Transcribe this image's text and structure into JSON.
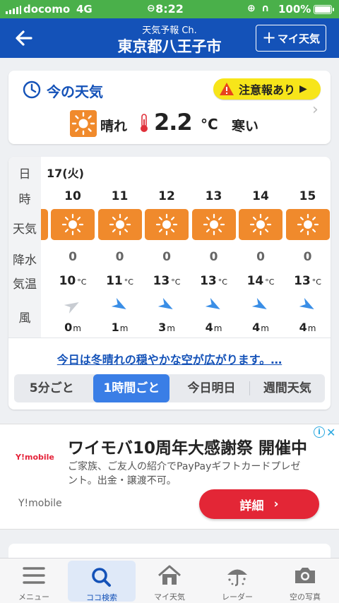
{
  "status_bar": {
    "carrier": "docomo",
    "network": "4G",
    "time": "8:22",
    "battery": "100%"
  },
  "header": {
    "subtitle": "天気予報 Ch.",
    "title": "東京都八王子市",
    "my_weather_button": "マイ天気"
  },
  "current": {
    "title": "今の天気",
    "alert": "注意報あり",
    "condition": "晴れ",
    "temperature": "2.2",
    "unit": "°C",
    "feel": "寒い",
    "icon": "sun-icon"
  },
  "hourly": {
    "labels": {
      "day": "日",
      "hour": "時",
      "weather": "天気",
      "precip": "降水",
      "temp": "気温",
      "wind": "風"
    },
    "date": "17(火)",
    "temp_unit": "°C",
    "wind_unit": "m",
    "hours": [
      {
        "hour": "10",
        "icon": "sun-icon",
        "precip": "0",
        "temp": "10",
        "wind": "0"
      },
      {
        "hour": "11",
        "icon": "sun-icon",
        "precip": "0",
        "temp": "11",
        "wind": "1"
      },
      {
        "hour": "12",
        "icon": "sun-icon",
        "precip": "0",
        "temp": "13",
        "wind": "3"
      },
      {
        "hour": "13",
        "icon": "sun-icon",
        "precip": "0",
        "temp": "13",
        "wind": "4"
      },
      {
        "hour": "14",
        "icon": "sun-icon",
        "precip": "0",
        "temp": "14",
        "wind": "4"
      },
      {
        "hour": "15",
        "icon": "sun-icon",
        "precip": "0",
        "temp": "13",
        "wind": "4"
      }
    ],
    "summary": "今日は冬晴れの穏やかな空が広がります。…",
    "segments": [
      "5分ごと",
      "1時間ごと",
      "今日明日",
      "週間天気"
    ],
    "active_segment": "1時間ごと"
  },
  "ad": {
    "logo": "Y!mobile",
    "title": "ワイモバ10周年大感謝祭 開催中",
    "description": "ご家族、ご友人の紹介でPayPayギフトカードプレゼント。出金・譲渡不可。",
    "brand": "Y!mobile",
    "button": "詳細"
  },
  "tabs": [
    {
      "label": "メニュー",
      "icon": "menu-icon"
    },
    {
      "label": "ココ検索",
      "icon": "search-icon"
    },
    {
      "label": "マイ天気",
      "icon": "home-icon"
    },
    {
      "label": "レーダー",
      "icon": "radar-umbrella-icon"
    },
    {
      "label": "空の写真",
      "icon": "camera-icon"
    }
  ],
  "active_tab": "ココ検索",
  "colors": {
    "status_green": "#4ab04a",
    "header_blue": "#1452b8",
    "sun_orange": "#f08a2c",
    "alert_yellow": "#f7e51a",
    "ad_red": "#e32636"
  }
}
